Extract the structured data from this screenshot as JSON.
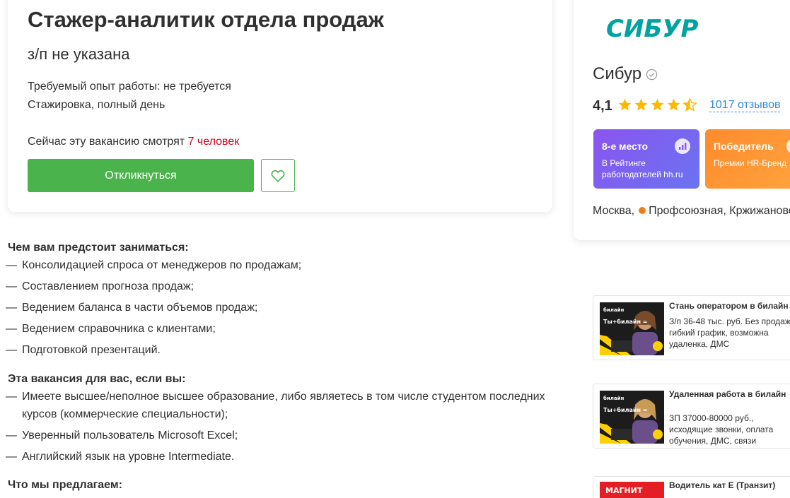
{
  "vacancy": {
    "title": "Стажер-аналитик отдела продаж",
    "salary": "з/п не указана",
    "experience": "Требуемый опыт работы: не требуется",
    "employment": "Стажировка, полный день",
    "watching_prefix": "Сейчас эту вакансию смотрят",
    "watching_count": "7 человек",
    "respond_label": "Откликнуться",
    "favorite_icon": "heart-icon"
  },
  "description": {
    "sections": [
      {
        "heading": "Чем вам предстоит заниматься:",
        "items": [
          "Консолидацией спроса от менеджеров по продажам;",
          "Составлением прогноза продаж;",
          "Ведением баланса в части объемов продаж;",
          "Ведением справочника с клиентами;",
          "Подготовкой презентаций."
        ]
      },
      {
        "heading": "Эта вакансия для вас, если вы:",
        "items": [
          "Имеете высшее/неполное высшее образование, либо являетесь в том числе студентом последних курсов (коммерческие специальности);",
          "Уверенный пользователь Microsoft Excel;",
          "Английский язык на уровне Intermediate."
        ]
      },
      {
        "heading": "Что мы предлагаем:",
        "items": []
      }
    ],
    "dash": "—"
  },
  "company": {
    "logo_text": "СИБУР",
    "name": "Сибур",
    "rating": "4,1",
    "stars": 4.5,
    "reviews": "1017 отзывов",
    "badge_rank": {
      "title": "8-е место",
      "text_line1": "В Рейтинге",
      "text_line2": "работодателей hh.ru"
    },
    "badge_winner": {
      "title": "Победитель",
      "text_line1": "Премии HR-Бренд"
    },
    "city": "Москва,",
    "metro": "Профсоюзная, Кржижановс",
    "metro_color": "#ef7f1a"
  },
  "ads": [
    {
      "title": "Стань оператором в билайн",
      "text": "З/п 36-48 тыс. руб. Без продаж, гибкий график, возможна удаленка, ДМС",
      "img_brand": "билайн",
      "img_caption": "Ты+билайн ="
    },
    {
      "title": "Удаленная работа в билайн",
      "text": "ЗП 37000-80000 руб., исходящие звонки, оплата обучения, ДМС, связи",
      "img_brand": "билайн",
      "img_caption": "Ты+билайн ="
    },
    {
      "title": "Водитель кат Е (Транзит)",
      "text": "",
      "img_brand": "МАГНИТ",
      "img_caption": ""
    }
  ],
  "colors": {
    "accent_green": "#4bb34b",
    "link_blue": "#2f89d8",
    "alert_red": "#d6001c",
    "star_yellow": "#ffb800",
    "sibur_logo": "#00a3a0"
  }
}
